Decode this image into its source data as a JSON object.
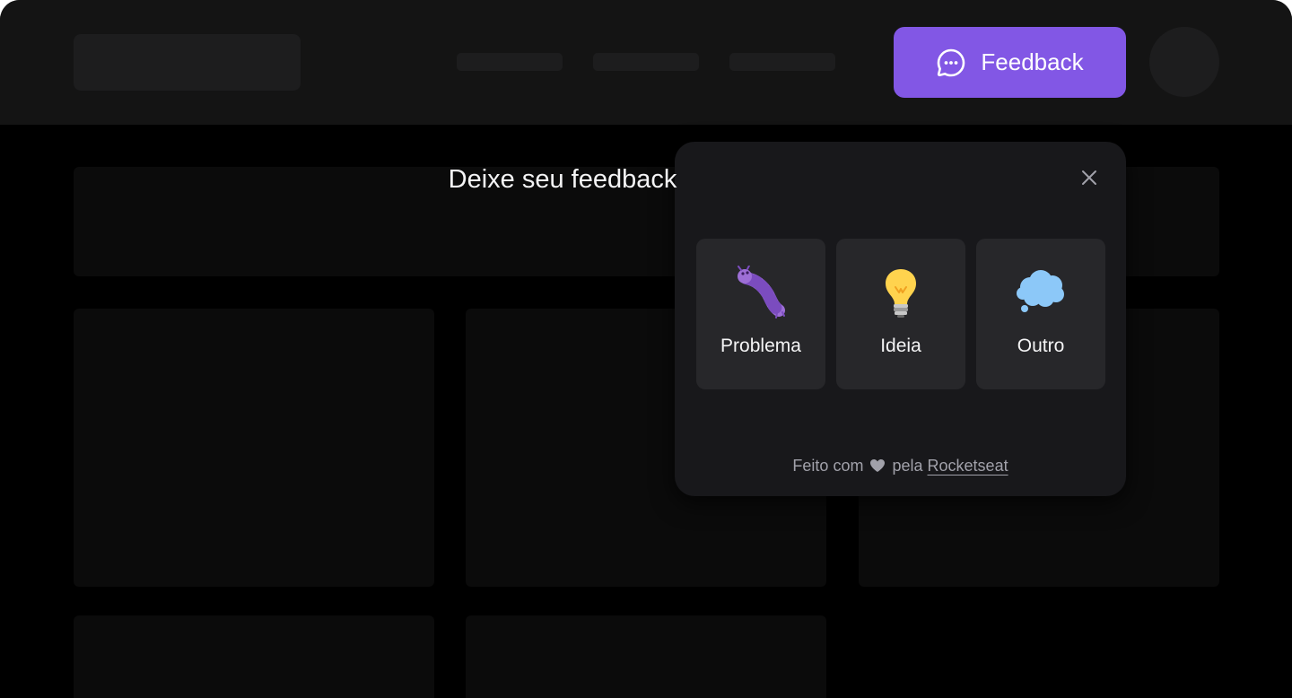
{
  "header": {
    "feedback_button": {
      "label": "Feedback",
      "icon": "chat-dots-icon"
    }
  },
  "widget": {
    "title": "Deixe seu feedback",
    "close_icon": "close-icon",
    "options": [
      {
        "label": "Problema",
        "icon": "bug-emoji"
      },
      {
        "label": "Ideia",
        "icon": "lightbulb-emoji"
      },
      {
        "label": "Outro",
        "icon": "thought-balloon-emoji"
      }
    ],
    "footer": {
      "prefix": "Feito com",
      "heart_icon": "heart-icon",
      "middle": "pela",
      "link_label": "Rocketseat"
    }
  },
  "colors": {
    "brand": "#8257e5",
    "widget_bg": "#18181b",
    "option_bg": "#27272a",
    "text": "#f4f4f5",
    "muted": "#a1a1aa"
  }
}
